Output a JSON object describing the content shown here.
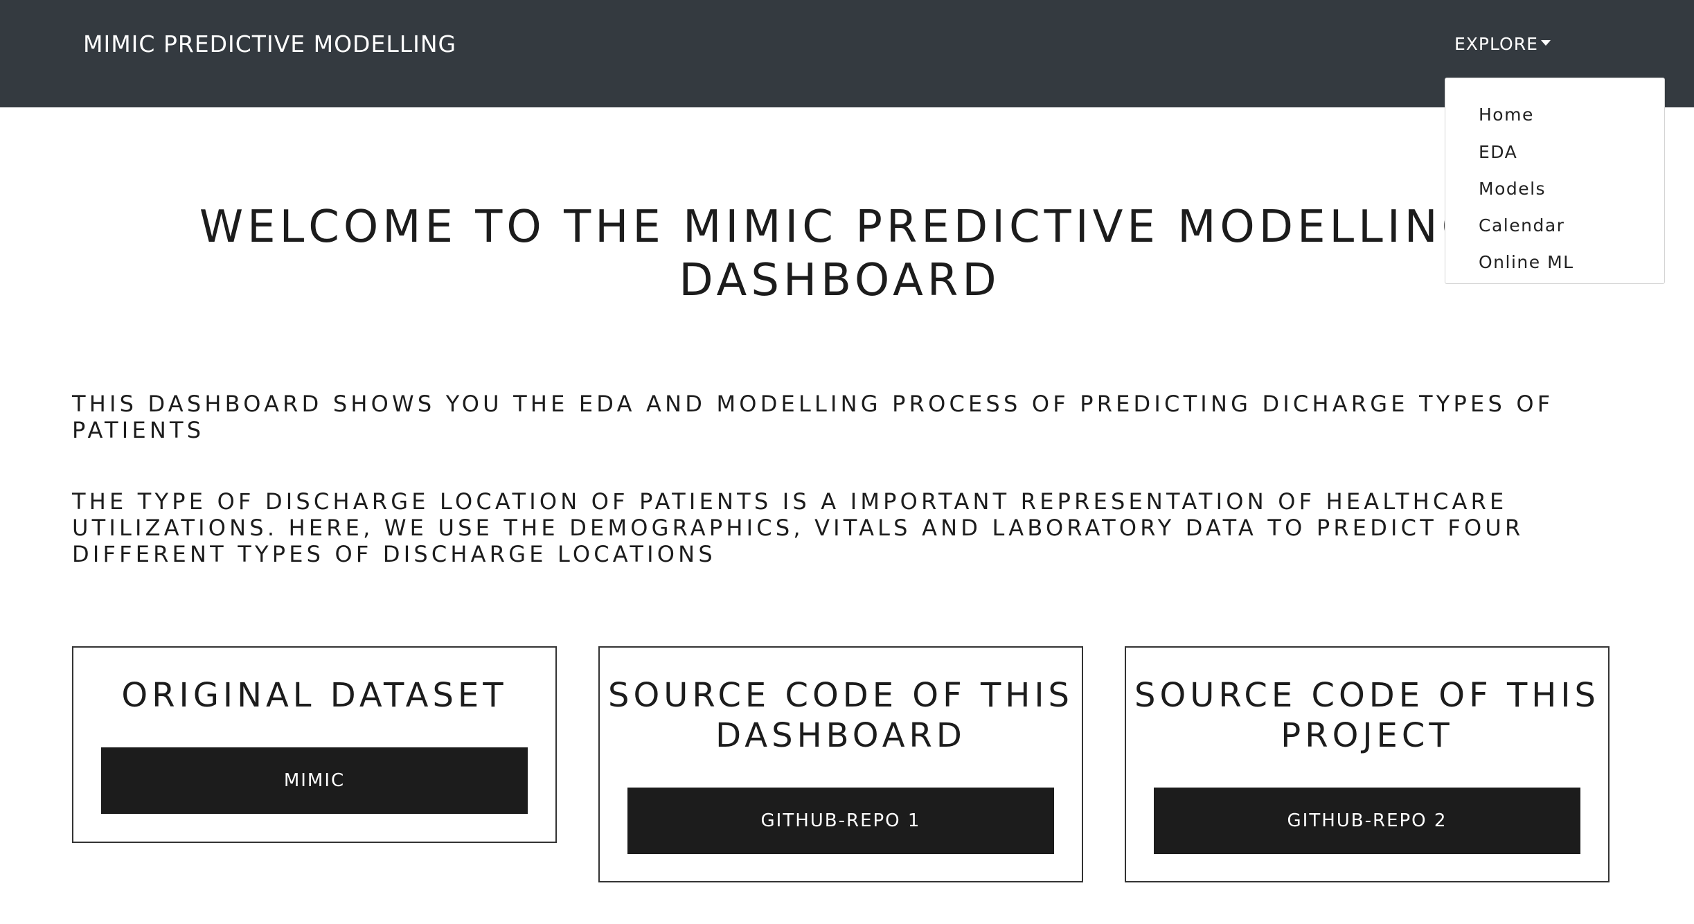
{
  "navbar": {
    "brand": "MIMIC PREDICTIVE MODELLING",
    "explore_label": "EXPLORE",
    "dropdown_items": [
      {
        "label": "Home"
      },
      {
        "label": "EDA"
      },
      {
        "label": "Models"
      },
      {
        "label": "Calendar"
      },
      {
        "label": "Online ML"
      }
    ]
  },
  "main": {
    "title": "WELCOME TO THE MIMIC PREDICTIVE MODELLING DASHBOARD",
    "intro_1": "THIS DASHBOARD SHOWS YOU THE EDA AND MODELLING PROCESS OF PREDICTING DICHARGE TYPES OF PATIENTS",
    "intro_2": "THE TYPE OF DISCHARGE LOCATION OF PATIENTS IS A IMPORTANT REPRESENTATION OF HEALTHCARE UTILIZATIONS. HERE, WE USE THE DEMOGRAPHICS, VITALS AND LABORATORY DATA TO PREDICT FOUR DIFFERENT TYPES OF DISCHARGE LOCATIONS"
  },
  "cards": [
    {
      "title": "ORIGINAL DATASET",
      "button_label": "MIMIC"
    },
    {
      "title": "SOURCE CODE OF THIS DASHBOARD",
      "button_label": "GITHUB-REPO 1"
    },
    {
      "title": "SOURCE CODE OF THIS PROJECT",
      "button_label": "GITHUB-REPO 2"
    }
  ],
  "colors": {
    "navbar_bg": "#343a40",
    "button_bg": "#1c1c1c",
    "text": "#1c1c1c"
  }
}
